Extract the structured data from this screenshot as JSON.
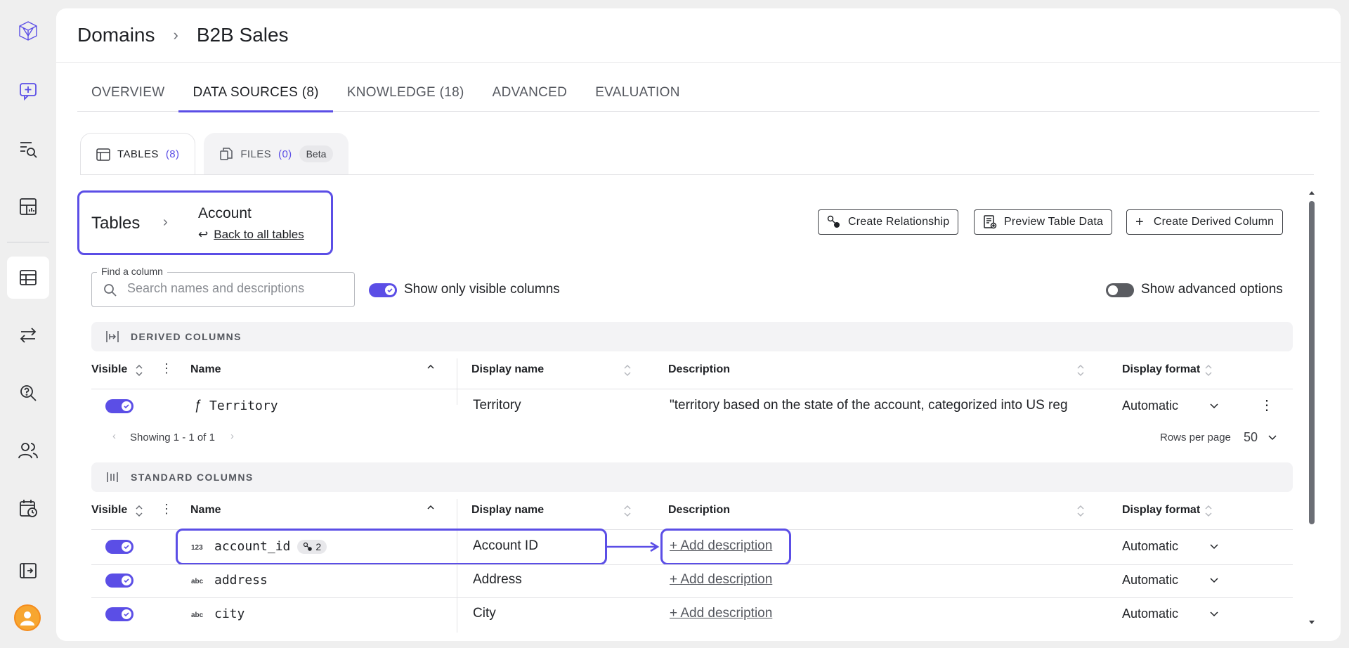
{
  "rail": {
    "items": [
      "logo-icon",
      "new-chat-icon",
      "search-list-icon",
      "dashboard-icon",
      "tables-icon",
      "transfer-icon",
      "query-search-icon",
      "users-icon",
      "schedule-icon",
      "expand-icon"
    ]
  },
  "header": {
    "crumbs": [
      "Domains",
      "B2B Sales"
    ]
  },
  "tabs": [
    {
      "label": "OVERVIEW"
    },
    {
      "label": "DATA SOURCES (8)"
    },
    {
      "label": "KNOWLEDGE (18)"
    },
    {
      "label": "ADVANCED"
    },
    {
      "label": "EVALUATION"
    }
  ],
  "subtabs": {
    "tables": {
      "label": "TABLES",
      "count": "(8)"
    },
    "files": {
      "label": "FILES",
      "count": "(0)",
      "badge": "Beta"
    }
  },
  "breadcrumb": {
    "root": "Tables",
    "current": "Account",
    "back_arrow": "↩",
    "back": "Back to all tables"
  },
  "actions": {
    "create_relationship": "Create Relationship",
    "preview": "Preview Table Data",
    "create_derived": "Create Derived Column"
  },
  "search": {
    "label": "Find a column",
    "placeholder": "Search names and descriptions",
    "value": ""
  },
  "toggles": {
    "visible_only": {
      "label": "Show only visible columns",
      "on": true
    },
    "advanced": {
      "label": "Show advanced options",
      "on": false
    }
  },
  "columns_header": {
    "visible": "Visible",
    "name": "Name",
    "display_name": "Display name",
    "description": "Description",
    "display_format": "Display format"
  },
  "derived": {
    "title": "DERIVED COLUMNS",
    "rows": [
      {
        "visible": true,
        "type": "ƒ",
        "name": "Territory",
        "display_name": "Territory",
        "description": "\"territory based on the state of the account, categorized into US reg",
        "format": "Automatic"
      }
    ],
    "pager": {
      "showing": "Showing 1 - 1 of 1",
      "rows_per_page_label": "Rows per page",
      "rows_per_page": "50"
    }
  },
  "standard": {
    "title": "STANDARD COLUMNS",
    "rows": [
      {
        "visible": true,
        "type": "123",
        "name": "account_id",
        "relations": "2",
        "display_name": "Account ID",
        "description": "+ Add description",
        "format": "Automatic"
      },
      {
        "visible": true,
        "type": "abc",
        "name": "address",
        "display_name": "Address",
        "description": "+ Add description",
        "format": "Automatic"
      },
      {
        "visible": true,
        "type": "abc",
        "name": "city",
        "display_name": "City",
        "description": "+ Add description",
        "format": "Automatic"
      }
    ]
  },
  "colors": {
    "accent": "#5b4ee6",
    "avatar": "#f7a630"
  }
}
